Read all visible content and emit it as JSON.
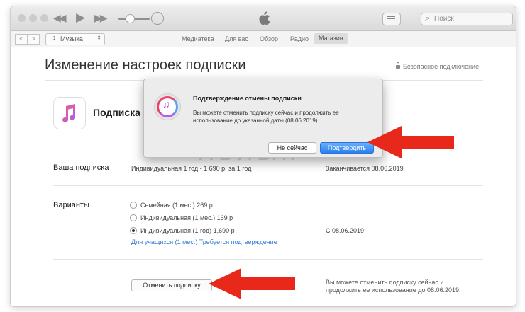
{
  "app": {
    "player": {
      "rewind_icon": "rewind-icon",
      "play_icon": "play-icon",
      "forward_icon": "fast-forward-icon",
      "airplay_icon": "airplay-icon"
    },
    "search_placeholder": "Поиск"
  },
  "navbar": {
    "source_selector": "Музыка",
    "tabs": [
      "Медиатека",
      "Для вас",
      "Обзор",
      "Радио",
      "Магазин"
    ],
    "active_tab": "Магазин"
  },
  "page": {
    "title": "Изменение настроек подписки",
    "secure_connection": "Безопасное подключение",
    "product_name": "Подписка ",
    "your_subscription": {
      "label": "Ваша подписка",
      "plan": "Индивидуальная 1 год - 1 690 р. за 1 год",
      "expires": "Заканчивается 08.06.2019"
    },
    "options": {
      "label": "Варианты",
      "items": [
        {
          "text": "Семейная (1 мес.) 269 р",
          "selected": false
        },
        {
          "text": "Индивидуальная (1 мес.) 169 р",
          "selected": false
        },
        {
          "text": "Индивидуальная (1 год) 1,690 р",
          "selected": true
        }
      ],
      "selected_date": "С 08.06.2019",
      "student_link": "Для учащихся (1 мес.) Требуется подтверждение"
    },
    "cancel_button": "Отменить подписку",
    "cancel_note_line1": "Вы можете отменить подписку сейчас и",
    "cancel_note_line2": "продолжить ее использование до 08.06.2019."
  },
  "watermark": "ЯБЛЫК",
  "dialog": {
    "title": "Подтверждение отмены подписки",
    "message_line1": "Вы можете отменить подписку сейчас и продолжить ее",
    "message_line2": "использование до указанной даты (08.06.2019).",
    "secondary_button": "Не сейчас",
    "primary_button": "Подтвердить"
  },
  "colors": {
    "accent": "#2c7ff0",
    "link": "#2f7ad6",
    "arrow": "#e8281b"
  }
}
